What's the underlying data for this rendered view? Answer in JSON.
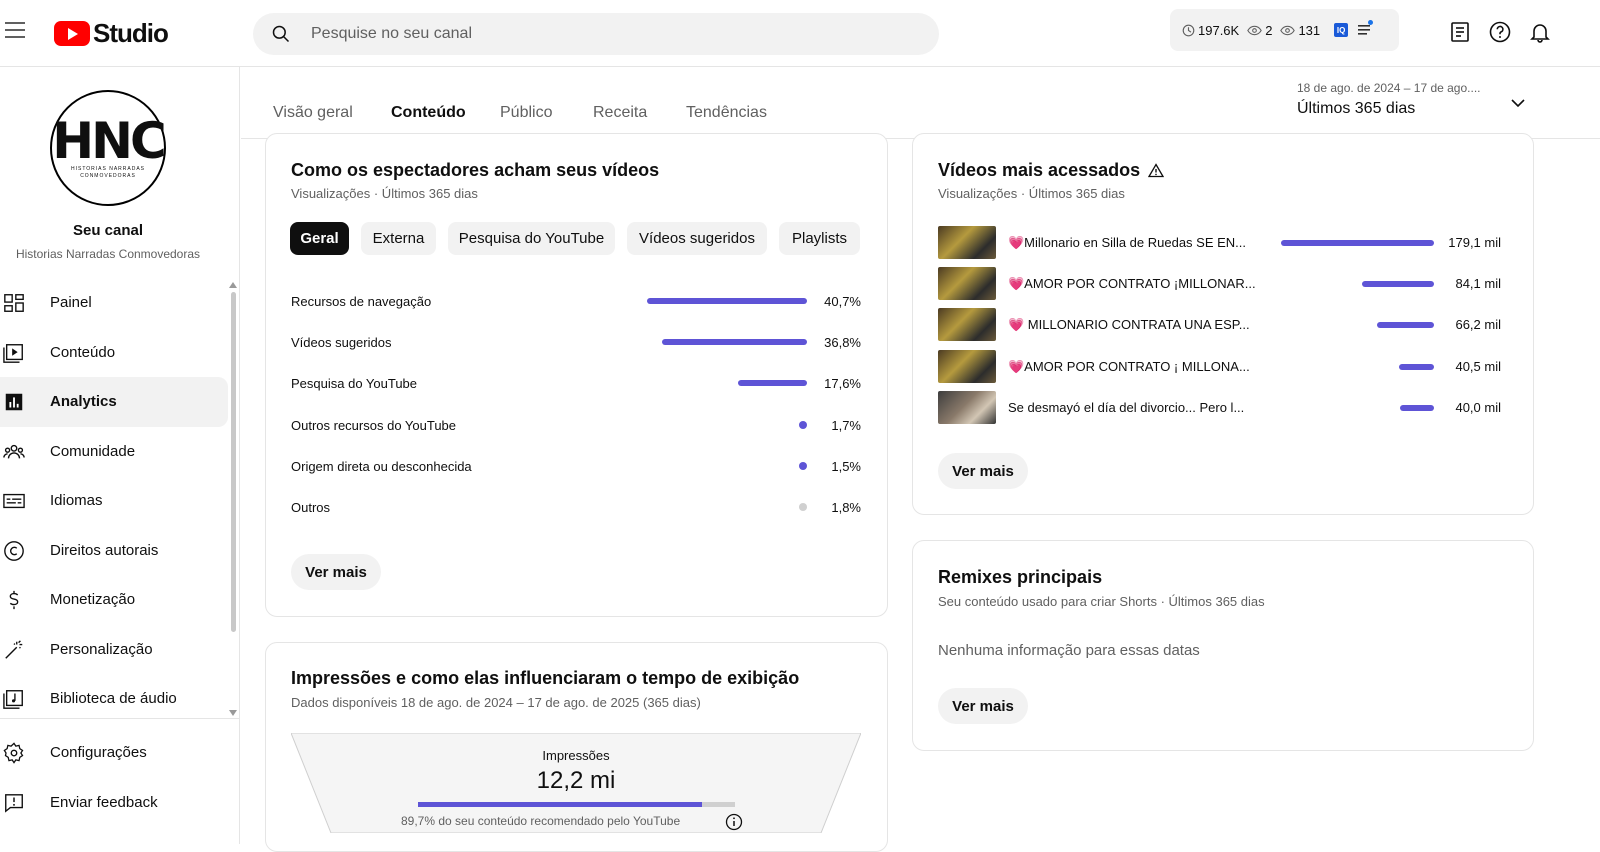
{
  "header": {
    "logo_text": "Studio",
    "search_placeholder": "Pesquise no seu canal",
    "stats": {
      "hours": "197.6K",
      "views_a": "2",
      "views_b": "131",
      "badge": "IQ"
    }
  },
  "sidebar": {
    "avatar": {
      "big": "HNC",
      "small": "HISTORIAS NARRADAS CONMOVEDORAS"
    },
    "channel_title": "Seu canal",
    "channel_name": "Historias Narradas Conmovedoras",
    "items": [
      {
        "label": "Painel",
        "icon": "dashboard-icon"
      },
      {
        "label": "Conteúdo",
        "icon": "content-icon"
      },
      {
        "label": "Analytics",
        "icon": "analytics-icon"
      },
      {
        "label": "Comunidade",
        "icon": "community-icon"
      },
      {
        "label": "Idiomas",
        "icon": "subtitles-icon"
      },
      {
        "label": "Direitos autorais",
        "icon": "copyright-icon"
      },
      {
        "label": "Monetização",
        "icon": "dollar-icon"
      },
      {
        "label": "Personalização",
        "icon": "magic-wand-icon"
      },
      {
        "label": "Biblioteca de áudio",
        "icon": "audio-library-icon"
      }
    ],
    "bottom_items": [
      {
        "label": "Configurações",
        "icon": "gear-icon"
      },
      {
        "label": "Enviar feedback",
        "icon": "feedback-icon"
      }
    ]
  },
  "tabs": {
    "items": [
      "Visão geral",
      "Conteúdo",
      "Público",
      "Receita",
      "Tendências"
    ],
    "active": "Conteúdo",
    "date_range": "18 de ago. de 2024 – 17 de ago....",
    "date_label": "Últimos 365 dias"
  },
  "discovery": {
    "title": "Como os espectadores acham seus vídeos",
    "subtitle": "Visualizações · Últimos 365 dias",
    "chips": [
      "Geral",
      "Externa",
      "Pesquisa do YouTube",
      "Vídeos sugeridos",
      "Playlists"
    ],
    "rows": [
      {
        "label": "Recursos de navegação",
        "value": "40,7%",
        "share": 40.7
      },
      {
        "label": "Vídeos sugeridos",
        "value": "36,8%",
        "share": 36.8
      },
      {
        "label": "Pesquisa do YouTube",
        "value": "17,6%",
        "share": 17.6
      },
      {
        "label": "Outros recursos do YouTube",
        "value": "1,7%",
        "share": 1.7
      },
      {
        "label": "Origem direta ou desconhecida",
        "value": "1,5%",
        "share": 1.5
      },
      {
        "label": "Outros",
        "value": "1,8%",
        "share": 1.8
      }
    ],
    "more_button": "Ver mais"
  },
  "impressions": {
    "title": "Impressões e como elas influenciaram o tempo de exibição",
    "subtitle": "Dados disponíveis 18 de ago. de 2024 – 17 de ago. de 2025 (365 dias)",
    "label": "Impressões",
    "value": "12,2 mi",
    "recommended_share": 0.897,
    "footnote": "89,7% do seu conteúdo recomendado pelo YouTube"
  },
  "top_videos": {
    "title": "Vídeos mais acessados",
    "subtitle": "Visualizações · Últimos 365 dias",
    "rows": [
      {
        "title": "💗Millonario en Silla de Ruedas SE EN...",
        "value": "179,1 mil",
        "views": 179.1
      },
      {
        "title": "💗AMOR POR CONTRATO ¡MILLONAR...",
        "value": "84,1 mil",
        "views": 84.1
      },
      {
        "title": "💗 MILLONARIO CONTRATA UNA ESP...",
        "value": "66,2 mil",
        "views": 66.2
      },
      {
        "title": "💗AMOR POR CONTRATO ¡ MILLONA...",
        "value": "40,5 mil",
        "views": 40.5
      },
      {
        "title": "Se desmayó el día del divorcio... Pero l...",
        "value": "40,0 mil",
        "views": 40.0
      }
    ],
    "more_button": "Ver mais"
  },
  "remixes": {
    "title": "Remixes principais",
    "subtitle": "Seu conteúdo usado para criar Shorts · Últimos 365 dias",
    "empty": "Nenhuma informação para essas datas",
    "more_button": "Ver mais"
  }
}
